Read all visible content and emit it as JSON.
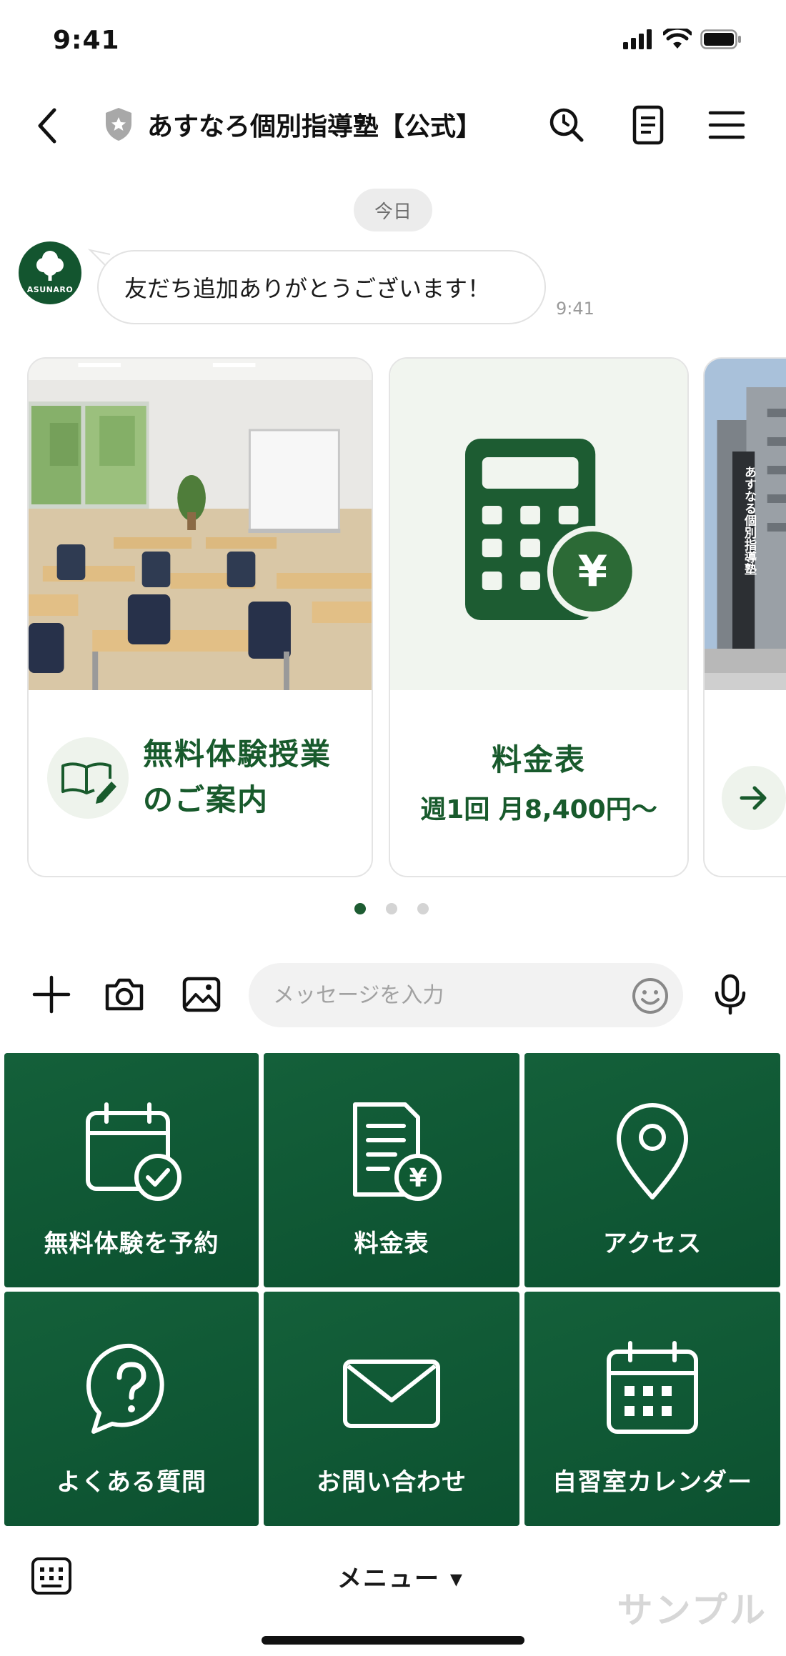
{
  "status_bar": {
    "time": "9:41"
  },
  "header": {
    "title": "あすなろ個別指導塾【公式】"
  },
  "chat": {
    "date_label": "今日",
    "avatar_text": "ASUNARO",
    "message": "友だち追加ありがとうございます！",
    "message_time": "9:41"
  },
  "carousel": {
    "cards": [
      {
        "title_line1": "無料体験授業",
        "title_line2": "のご案内"
      },
      {
        "title": "料金表",
        "subtitle": "週1回 月8,400円〜"
      },
      {
        "sign_text": "あすなる個別指導塾"
      }
    ],
    "page_count": 3,
    "active_page": 1
  },
  "input_bar": {
    "placeholder": "メッセージを入力"
  },
  "rich_menu": {
    "items": [
      {
        "label": "無料体験を予約",
        "icon": "calendar-check-icon"
      },
      {
        "label": "料金表",
        "icon": "document-yen-icon"
      },
      {
        "label": "アクセス",
        "icon": "map-pin-icon"
      },
      {
        "label": "よくある質問",
        "icon": "question-bubble-icon"
      },
      {
        "label": "お問い合わせ",
        "icon": "envelope-icon"
      },
      {
        "label": "自習室カレンダー",
        "icon": "calendar-grid-icon"
      }
    ]
  },
  "bottom_bar": {
    "menu_label": "メニュー ▾",
    "watermark": "サンプル"
  },
  "colors": {
    "brand_green": "#0f5a33",
    "text_green": "#185a2c",
    "light_green_bg": "#eef3ec"
  }
}
